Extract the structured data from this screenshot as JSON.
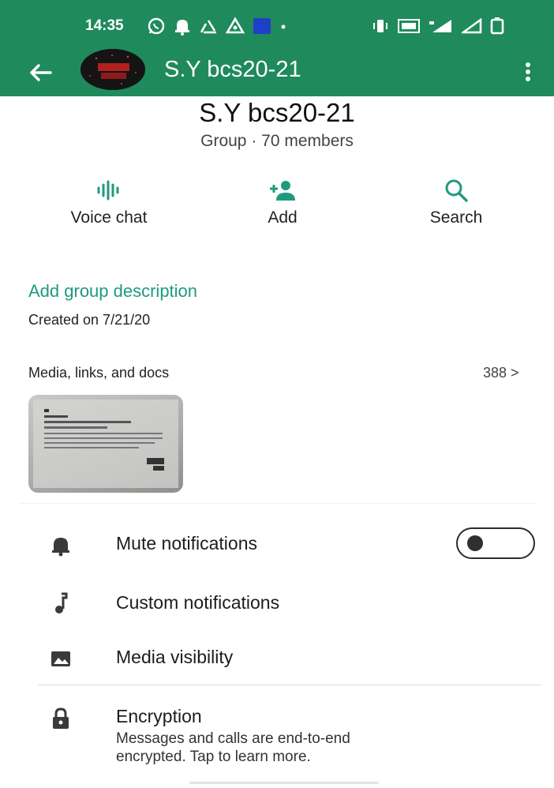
{
  "status_bar": {
    "time": "14:35",
    "left_icons": [
      "whatsapp-icon",
      "bell-icon",
      "recycle-icon",
      "warning-icon",
      "app-badge-icon"
    ],
    "right_icons": [
      "vibrate-icon",
      "volte-icon",
      "signal-icon",
      "signal-icon-2",
      "battery-icon"
    ]
  },
  "header": {
    "title": "S.Y bcs20-21",
    "accent_color": "#1f8a5c"
  },
  "profile": {
    "name": "S.Y bcs20-21",
    "subtitle": "Group · 70 members"
  },
  "actions": [
    {
      "label": "Voice chat",
      "icon": "voice-chat-icon"
    },
    {
      "label": "Add",
      "icon": "add-person-icon"
    },
    {
      "label": "Search",
      "icon": "search-icon"
    }
  ],
  "description": {
    "add_label": "Add group description",
    "created": "Created on 7/21/20"
  },
  "media": {
    "title": "Media, links, and docs",
    "count": "388 >"
  },
  "settings": [
    {
      "label": "Mute notifications",
      "icon": "bell-icon",
      "toggle_on": false
    },
    {
      "label": "Custom notifications",
      "icon": "music-note-icon"
    },
    {
      "label": "Media visibility",
      "icon": "image-icon"
    },
    {
      "label": "Encryption",
      "icon": "lock-icon",
      "sub_line1": "Messages and calls are end-to-end",
      "sub_line2": "encrypted. Tap to learn more."
    }
  ]
}
